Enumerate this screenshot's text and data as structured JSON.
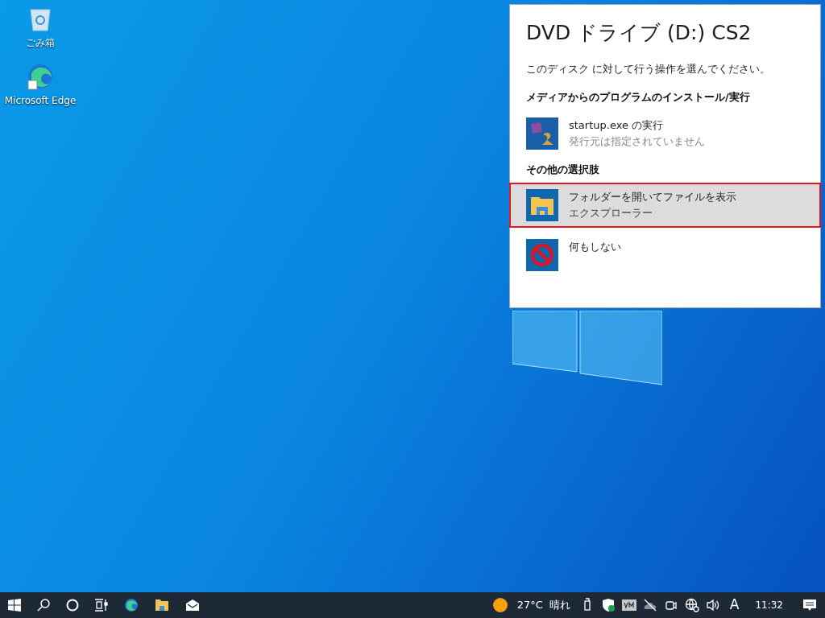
{
  "desktop_icons": [
    {
      "label": "ごみ箱",
      "kind": "recycle"
    },
    {
      "label": "Microsoft Edge",
      "kind": "edge"
    }
  ],
  "autoplay": {
    "title": "DVD ドライブ (D:) CS2",
    "prompt": "このディスク に対して行う操作を選んでください。",
    "sections": [
      {
        "heading": "メディアからのプログラムのインストール/実行",
        "options": [
          {
            "title": "startup.exe の実行",
            "subtitle": "発行元は指定されていません",
            "kind": "app",
            "selected": false
          }
        ]
      },
      {
        "heading": "その他の選択肢",
        "options": [
          {
            "title": "フォルダーを開いてファイルを表示",
            "subtitle": "エクスプローラー",
            "kind": "folder",
            "selected": true
          },
          {
            "title": "何もしない",
            "kind": "none",
            "selected": false
          }
        ]
      }
    ]
  },
  "taskbar": {
    "temperature": "27°C",
    "condition": "晴れ",
    "ime": "A",
    "clock": "11:32"
  }
}
